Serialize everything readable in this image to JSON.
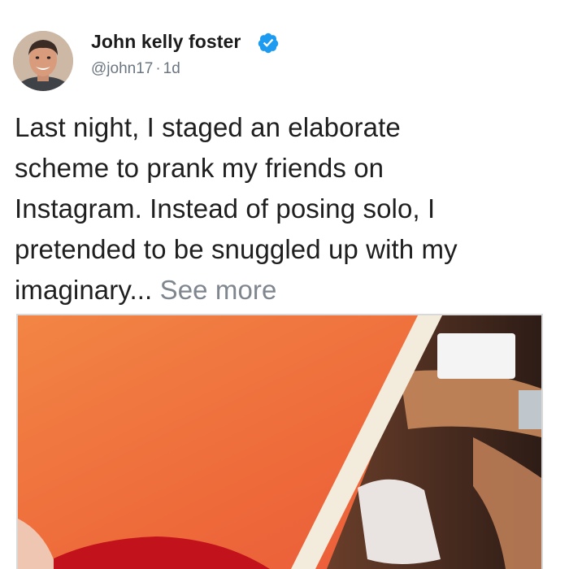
{
  "author": {
    "name": "John kelly foster",
    "handle": "@john17",
    "separator": "·",
    "time_ago": "1d"
  },
  "post": {
    "lines": [
      "Last night, I staged an elaborate",
      "scheme to prank my friends on",
      "Instagram. Instead of posing solo, I",
      "pretended to be snuggled up with my"
    ],
    "last_line": "imaginary...",
    "see_more_label": "See more"
  },
  "icons": {
    "verified": "verified-badge-icon"
  },
  "colors": {
    "verified_badge": "#1d9bf0",
    "see_more": "#7f868d",
    "photo_background": "#ef6e3c"
  }
}
